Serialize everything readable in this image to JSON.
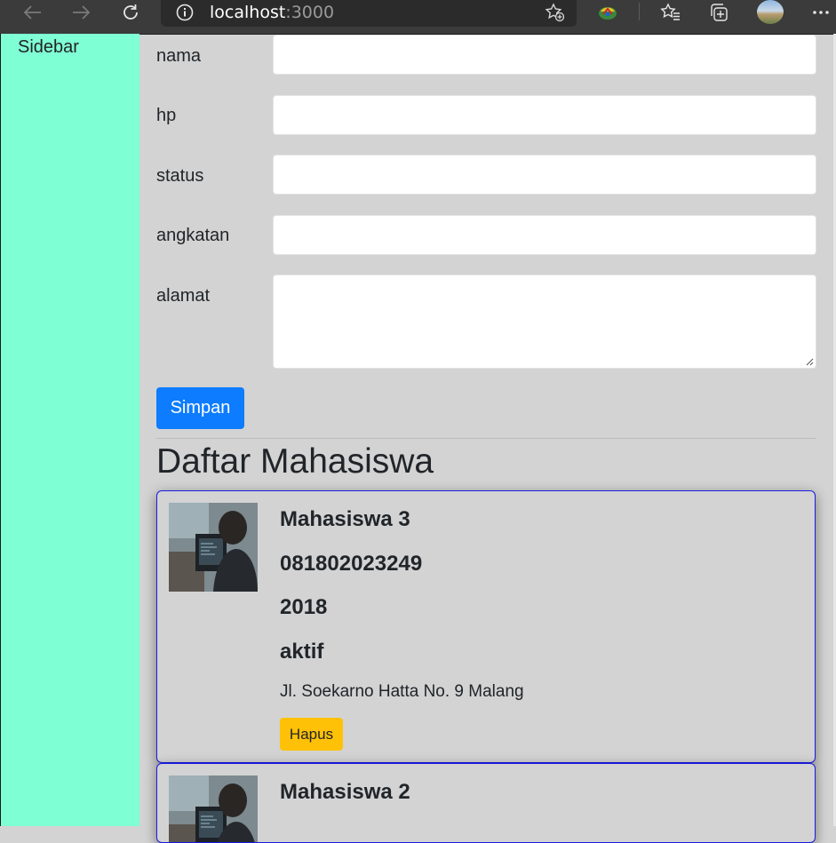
{
  "browser": {
    "url_host": "localhost",
    "url_port": ":3000"
  },
  "sidebar": {
    "title": "Sidebar"
  },
  "form": {
    "fields": [
      {
        "label": "nama",
        "value": ""
      },
      {
        "label": "hp",
        "value": ""
      },
      {
        "label": "status",
        "value": ""
      },
      {
        "label": "angkatan",
        "value": ""
      },
      {
        "label": "alamat",
        "value": ""
      }
    ],
    "submit_label": "Simpan"
  },
  "list": {
    "heading": "Daftar Mahasiswa",
    "cards": [
      {
        "nama": "Mahasiswa 3",
        "hp": "081802023249",
        "angkatan": "2018",
        "status": "aktif",
        "alamat": "Jl. Soekarno Hatta No. 9 Malang",
        "delete_label": "Hapus"
      },
      {
        "nama": "Mahasiswa 2"
      }
    ]
  },
  "colors": {
    "sidebar": "#7fffd4",
    "primary": "#0d7cff",
    "warning": "#ffc107",
    "card_border": "#1a1ae0",
    "background": "#d3d3d3"
  }
}
